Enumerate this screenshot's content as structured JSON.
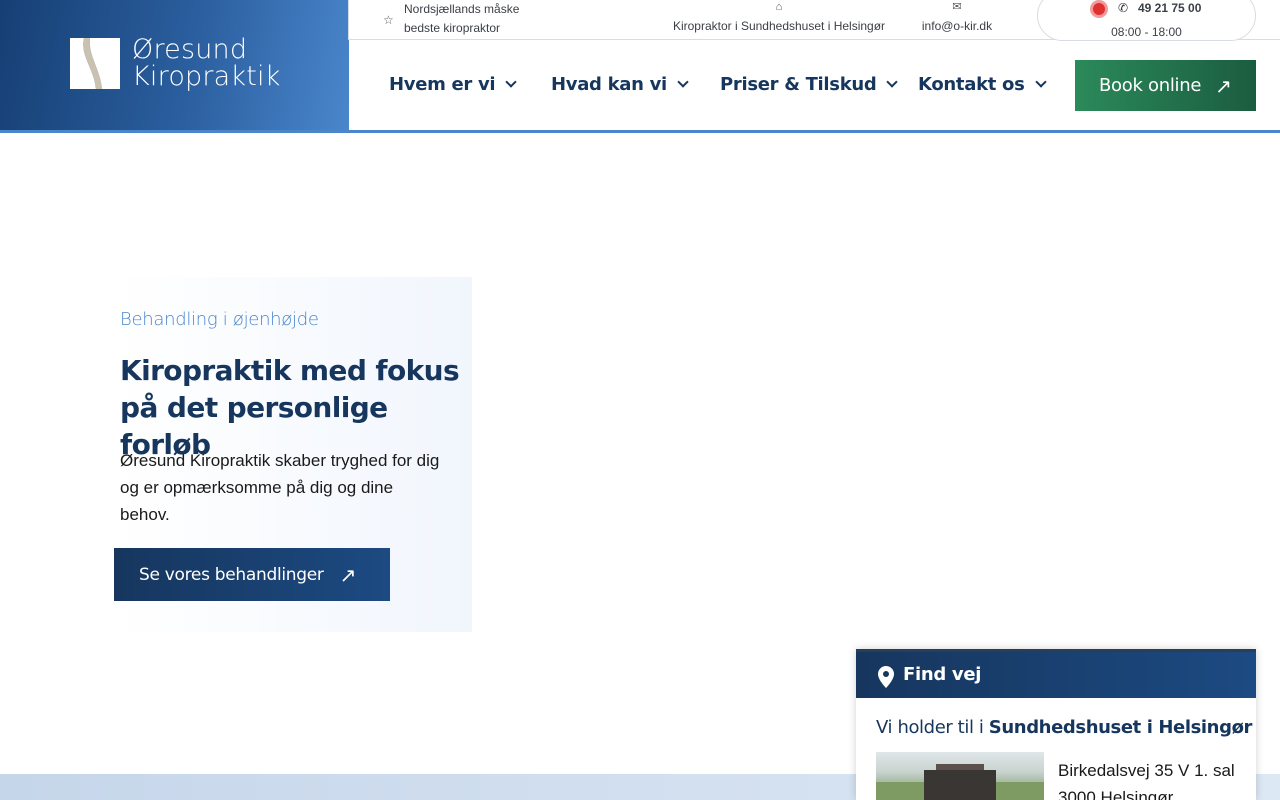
{
  "logo": {
    "line1": "Øresund",
    "line2": "Kiropraktik"
  },
  "topbar": {
    "tagline": "Nordsjællands måske bedste kiropraktor",
    "location": "Kiropraktor i Sundhedshuset i Helsingør",
    "email": "info@o-kir.dk",
    "phone": "49 21 75 00",
    "hours": "08:00 - 18:00"
  },
  "nav": {
    "items": [
      {
        "label": "Hvem er vi"
      },
      {
        "label": "Hvad kan vi"
      },
      {
        "label": "Priser & Tilskud"
      },
      {
        "label": "Kontakt os"
      }
    ],
    "book_label": "Book online"
  },
  "hero": {
    "eyebrow": "Behandling i øjenhøjde",
    "title": "Kiropraktik med fokus på det personlige forløb",
    "text": "Øresund Kiropraktik skaber tryghed for dig og er opmærksomme på dig og dine behov.",
    "cta_label": "Se vores behandlinger"
  },
  "findvej": {
    "title": "Find vej",
    "sub_prefix": "Vi holder til i",
    "sub_place": "Sundhedshuset i Helsingør",
    "address_line1": "Birkedalsvej 35 V 1. sal",
    "address_line2": "3000 Helsingør"
  },
  "colors": {
    "brand_dark": "#16365e",
    "brand_light": "#4a86cc",
    "book_green": "#2b8a5a",
    "status_red": "#e03131"
  }
}
